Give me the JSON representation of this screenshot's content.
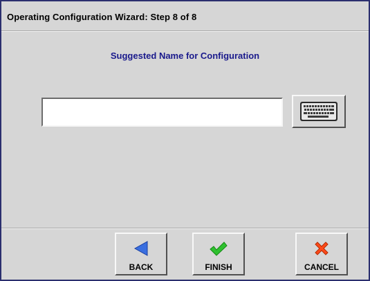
{
  "window": {
    "title": "Operating Configuration Wizard:  Step 8 of 8"
  },
  "content": {
    "heading": "Suggested Name for Configuration",
    "name_input": {
      "value": "",
      "placeholder": ""
    },
    "keyboard_button": {
      "icon": "keyboard-icon"
    }
  },
  "footer": {
    "back": {
      "label": "BACK",
      "icon": "left-arrow-icon",
      "color": "#3a6fe0"
    },
    "finish": {
      "label": "FINISH",
      "icon": "checkmark-icon",
      "color": "#2fc02f"
    },
    "cancel": {
      "label": "CANCEL",
      "icon": "x-icon",
      "color": "#ff4a1a"
    }
  },
  "colors": {
    "background": "#d6d6d6",
    "heading": "#1a1a8c",
    "window_border": "#2b2f6e"
  }
}
